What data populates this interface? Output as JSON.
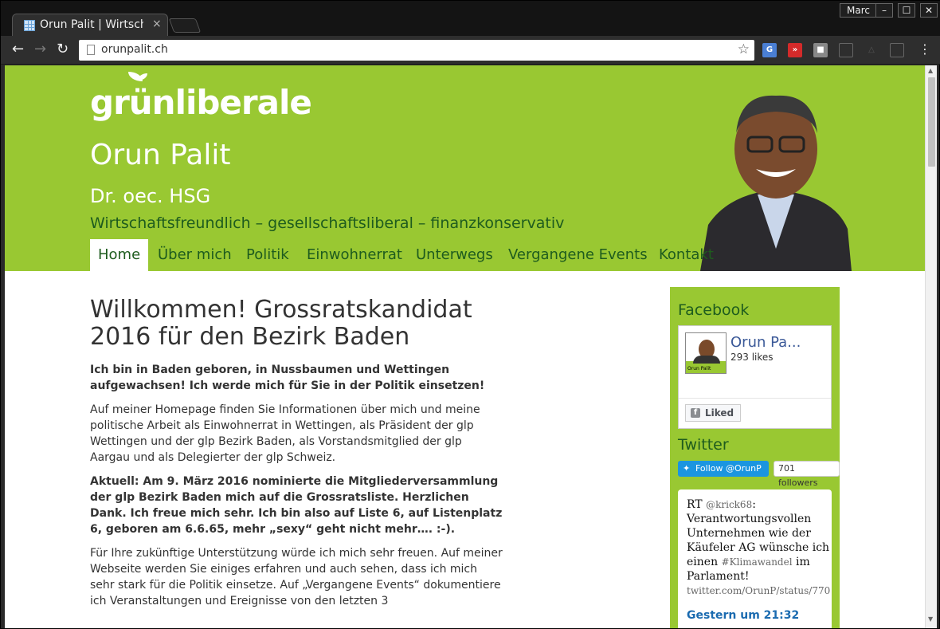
{
  "browser": {
    "tab_title": "Orun Palit | Wirtschaft",
    "tab_close": "×",
    "user": "Marc",
    "url": "orunpalit.ch",
    "minimize": "–",
    "maximize": "☐",
    "close": "✕"
  },
  "site": {
    "logo": "grünliberale",
    "name": "Orun Palit",
    "degree": "Dr. oec. HSG",
    "tagline": "Wirtschaftsfreundlich – gesellschaftsliberal – finanzkonservativ",
    "nav": [
      "Home",
      "Über mich",
      "Politik",
      "Einwohnerrat",
      "Unterwegs",
      "Vergangene Events",
      "Kontakt"
    ],
    "active_nav": "Home",
    "brand_color": "#99c832"
  },
  "main": {
    "title": "Willkommen! Grossratskandidat 2016 für den Bezirk Baden",
    "intro": "Ich bin in Baden geboren, in Nussbaumen und Wettingen aufgewachsen! Ich werde mich für Sie in der Politik einsetzen!",
    "para1": "Auf meiner Homepage finden Sie Informationen über mich und meine politische Arbeit als Einwohnerrat in Wettingen, als Präsident der glp Wettingen und der glp Bezirk Baden, als Vorstandsmitglied der glp Aargau und als Delegierter der glp Schweiz.",
    "news": "Aktuell: Am 9. März 2016 nominierte die Mitgliederversammlung der glp Bezirk Baden mich auf die Grossratsliste. Herzlichen Dank. Ich freue mich sehr. Ich bin also auf Liste 6, auf Listenplatz 6, geboren am 6.6.65, mehr „sexy“ geht nicht mehr…. :-).",
    "para2": "Für Ihre zukünftige Unterstützung würde ich mich sehr freuen. Auf meiner Webseite werden Sie einiges erfahren und auch sehen, dass ich mich sehr stark für die Politik einsetze. Auf „Vergangene Events“ dokumentiere ich Veranstaltungen und Ereignisse von den letzten 3"
  },
  "sidebar": {
    "facebook_title": "Facebook",
    "fb_name": "Orun Pa...",
    "fb_likes": "293 likes",
    "fb_liked": "Liked",
    "fb_thumb_label": "Orun Palit",
    "twitter_title": "Twitter",
    "tw_follow": "Follow @OrunP",
    "tw_followers": "701 followers",
    "tweet_rt": "RT",
    "tweet_handle": "@krick68",
    "tweet_body": ": Verantwortungsvollen Unternehmen wie der Käufeler AG wünsche ich einen",
    "tweet_hashtag": "#Klimawandel",
    "tweet_end": " im Parlament!",
    "tweet_link": "twitter.com/OrunP/status/770",
    "tweet_time": "Gestern um 21:32"
  }
}
